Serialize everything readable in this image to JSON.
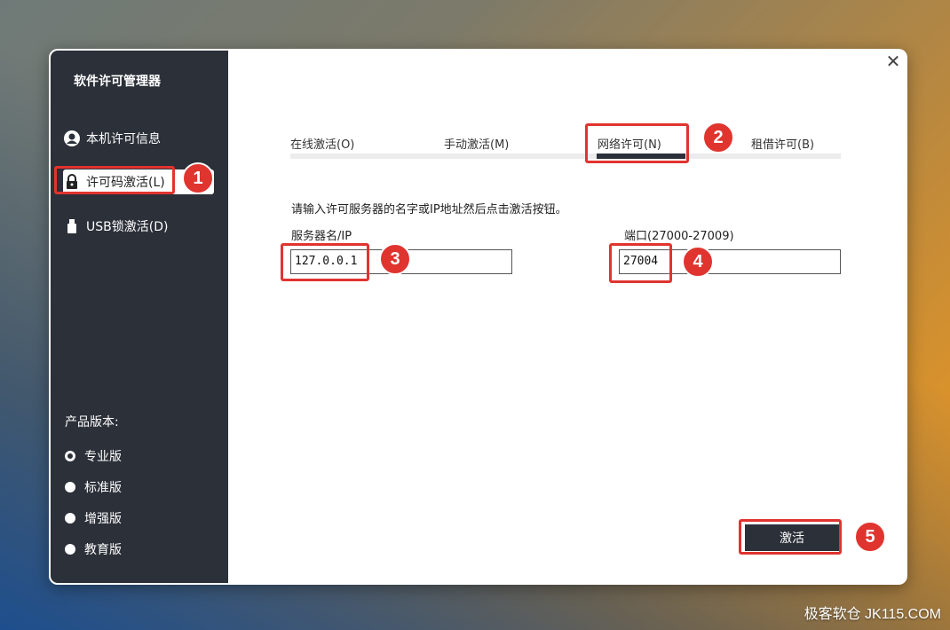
{
  "sidebar": {
    "title": "软件许可管理器",
    "items": [
      {
        "label": "本机许可信息",
        "icon": "user-icon"
      },
      {
        "label": "许可码激活(L)",
        "icon": "lock-icon"
      },
      {
        "label": "USB锁激活(D)",
        "icon": "usb-icon"
      }
    ],
    "version_label": "产品版本:",
    "versions": [
      {
        "label": "专业版",
        "checked": true
      },
      {
        "label": "标准版",
        "checked": false
      },
      {
        "label": "增强版",
        "checked": false
      },
      {
        "label": "教育版",
        "checked": false
      }
    ]
  },
  "tabs": [
    {
      "label": "在线激活(O)"
    },
    {
      "label": "手动激活(M)"
    },
    {
      "label": "网络许可(N)",
      "active": true
    },
    {
      "label": "租借许可(B)"
    }
  ],
  "form": {
    "instructions": "请输入许可服务器的名字或IP地址然后点击激活按钮。",
    "server_label": "服务器名/IP",
    "server_value": "127.0.0.1",
    "port_label": "端口(27000-27009)",
    "port_value": "27004",
    "activate_label": "激活"
  },
  "badges": [
    "1",
    "2",
    "3",
    "4",
    "5"
  ],
  "watermark": "极客软仓 JK115.COM",
  "colors": {
    "sidebar": "#2b3039",
    "highlight": "#e0342f"
  }
}
